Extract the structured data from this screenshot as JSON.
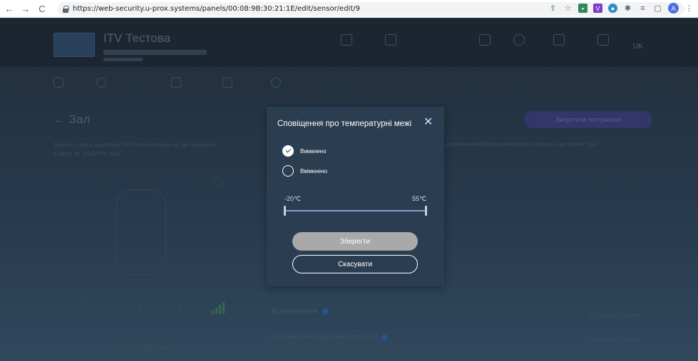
{
  "browser": {
    "url": "https://web-security.u-prox.systems/panels/00:08:9B:30:21:1E/edit/sensor/edit/9",
    "profile_initial": "A"
  },
  "app": {
    "brand": "ITV Тестова",
    "language": "UK",
    "page_title": "← Зал",
    "test_button": "Запустити тестування",
    "description_line1": "Зверніть увагу що датчик PIR Combi працює на дві суміжні ох",
    "description_line2": "а другу як \"розбиття скла\"",
    "description_right": "ключенні необхідно налаштувати першу з цих зон як \"рух\",",
    "device_name": "04-10 | PIR Combi",
    "install_label": "Встановлення",
    "install_break_label": "Встановлення датчика розбиття",
    "right_items": [
      "Внутрішня охорона",
      "Внутрішня охорона"
    ]
  },
  "modal": {
    "title": "Сповіщення про температурні межі",
    "options": [
      {
        "label": "Вимкнено",
        "checked": true
      },
      {
        "label": "Ввімкнено",
        "checked": false
      }
    ],
    "range": {
      "min_label": "-20℃",
      "max_label": "55℃",
      "min": -20,
      "max": 55
    },
    "save_label": "Зберегти",
    "cancel_label": "Скасувати"
  },
  "colors": {
    "modal_bg": "#2b3d51",
    "save_disabled": "#a9a9a9",
    "accent": "#3a3d7a"
  }
}
